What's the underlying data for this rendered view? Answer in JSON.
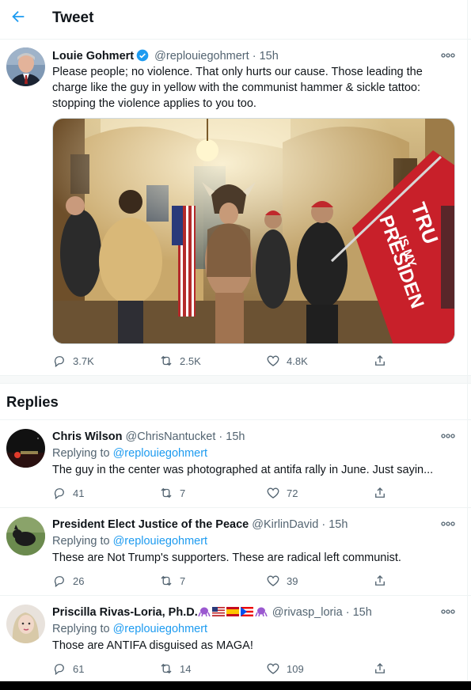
{
  "header": {
    "title": "Tweet"
  },
  "main_tweet": {
    "name": "Louie Gohmert",
    "handle": "@replouiegohmert",
    "separator": "·",
    "time": "15h",
    "text": "Please people; no violence. That only hurts our cause. Those leading the charge like the guy in yellow with the communist hammer & sickle tattoo: stopping the violence applies to you too.",
    "flag_text_1": "TRU",
    "flag_text_2": "IS MY",
    "flag_text_3": "PRESIDEN",
    "counts": {
      "replies": "3.7K",
      "retweets": "2.5K",
      "likes": "4.8K"
    }
  },
  "replies_title": "Replies",
  "replies": [
    {
      "name": "Chris Wilson",
      "handle": "@ChrisNantucket",
      "separator": "·",
      "time": "15h",
      "replying_prefix": "Replying to",
      "replying_to": "@replouiegohmert",
      "text": "The guy in the center was photographed at antifa rally in June.  Just sayin...",
      "counts": {
        "replies": "41",
        "retweets": "7",
        "likes": "72"
      }
    },
    {
      "name": "President Elect Justice of the Peace",
      "handle": "@KirlinDavid",
      "separator": "·",
      "time": "15h",
      "replying_prefix": "Replying to",
      "replying_to": "@replouiegohmert",
      "text": "These are Not Trump's supporters. These are radical left communist.",
      "counts": {
        "replies": "26",
        "retweets": "7",
        "likes": "39"
      }
    },
    {
      "name": "Priscilla Rivas-Loria, Ph.D.",
      "handle": "@rivasp_loria",
      "separator": "·",
      "time": "15h",
      "replying_prefix": "Replying to",
      "replying_to": "@replouiegohmert",
      "text": "Those are ANTIFA disguised as MAGA!",
      "counts": {
        "replies": "61",
        "retweets": "14",
        "likes": "109"
      }
    }
  ],
  "colors": {
    "accent": "#1d9bf0",
    "muted": "#536471",
    "text": "#0f1419"
  }
}
